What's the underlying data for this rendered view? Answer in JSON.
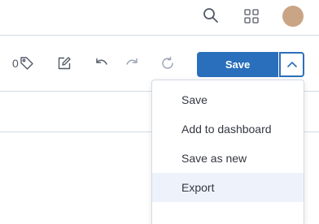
{
  "header": {
    "icons": [
      "search-icon",
      "apps-grid-icon"
    ],
    "avatar_color": "#c9a585"
  },
  "toolbar": {
    "tag_count": "0",
    "save_label": "Save",
    "accent_color": "#2a6fbb"
  },
  "save_menu": {
    "items": [
      {
        "label": "Save"
      },
      {
        "label": "Add to dashboard"
      },
      {
        "label": "Save as new"
      },
      {
        "label": "Export",
        "highlighted": true
      }
    ]
  }
}
